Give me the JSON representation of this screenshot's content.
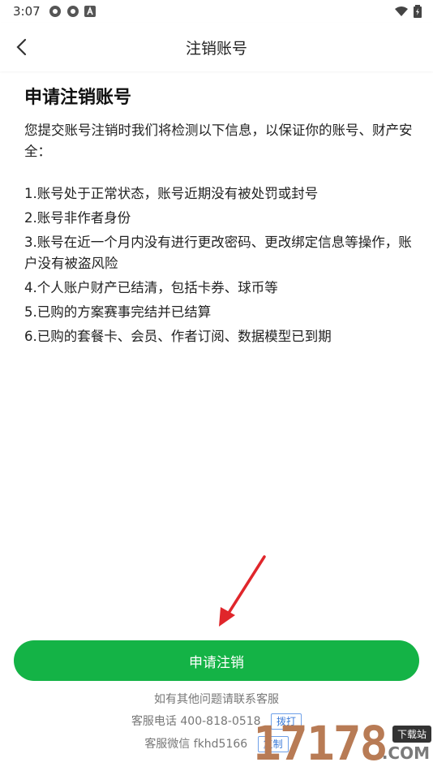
{
  "status_bar": {
    "time": "3:07"
  },
  "nav": {
    "title": "注销账号"
  },
  "content": {
    "heading": "申请注销账号",
    "intro": "您提交账号注销时我们将检测以下信息，以保证你的账号、财产安全：",
    "rules": [
      "1.账号处于正常状态，账号近期没有被处罚或封号",
      "2.账号非作者身份",
      "3.账号在近一个月内没有进行更改密码、更改绑定信息等操作，账户没有被盗风险",
      "4.个人账户财产已结清，包括卡券、球币等",
      "5.已购的方案赛事完结并已结算",
      "6.已购的套餐卡、会员、作者订阅、数据模型已到期"
    ]
  },
  "apply_button": "申请注销",
  "footer": {
    "contact_hint": "如有其他问题请联系客服",
    "phone_label": "客服电话",
    "phone_number": "400-818-0518",
    "call_button": "拨打",
    "wechat_label": "客服微信",
    "wechat_id": "fkhd5166",
    "copy_button": "复制"
  },
  "watermark": {
    "digits": "17178",
    "tag": "下载站",
    "domain": ".COM"
  },
  "colors": {
    "accent": "#14b346",
    "link": "#3a7ad8",
    "arrow": "#e0262b"
  }
}
